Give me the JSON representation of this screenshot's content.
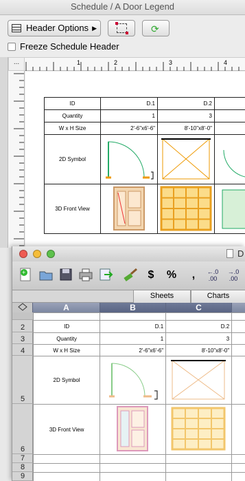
{
  "schedule_window": {
    "title": "Schedule / A Door Legend",
    "header_options_label": "Header Options",
    "freeze_label": "Freeze Schedule Header",
    "ruler_corner": "...",
    "ruler_numbers": [
      "1",
      "2",
      "3",
      "4"
    ]
  },
  "schedule_table": {
    "rows": [
      {
        "label": "ID",
        "d1": "D.1",
        "d2": "D.2"
      },
      {
        "label": "Quantity",
        "d1": "1",
        "d2": "3"
      },
      {
        "label": "W x H Size",
        "d1": "2'-6\"x6'-6\"",
        "d2": "8'-10\"x8'-0\""
      },
      {
        "label": "2D Symbol"
      },
      {
        "label": "3D Front View"
      }
    ]
  },
  "sheet_window": {
    "title_initial": "D",
    "tabs": [
      "Sheets",
      "Charts"
    ],
    "columns": [
      "A",
      "B",
      "C"
    ],
    "row_numbers": [
      "2",
      "3",
      "4",
      "5",
      "6",
      "7",
      "8",
      "9"
    ],
    "toolbar_glyphs": {
      "currency": "$",
      "percent": "%",
      "comma": ",",
      "dec_inc": "←.0 .00",
      "dec_dec": "→.0 .00"
    }
  },
  "sheet_table": {
    "rows": [
      {
        "label": "ID",
        "d1": "D.1",
        "d2": "D.2"
      },
      {
        "label": "Quantity",
        "d1": "1",
        "d2": "3"
      },
      {
        "label": "W x H Size",
        "d1": "2'-6\"x6'-6\"",
        "d2": "8'-10\"x8'-0\""
      },
      {
        "label": "2D Symbol"
      },
      {
        "label": "3D Front View"
      }
    ]
  }
}
